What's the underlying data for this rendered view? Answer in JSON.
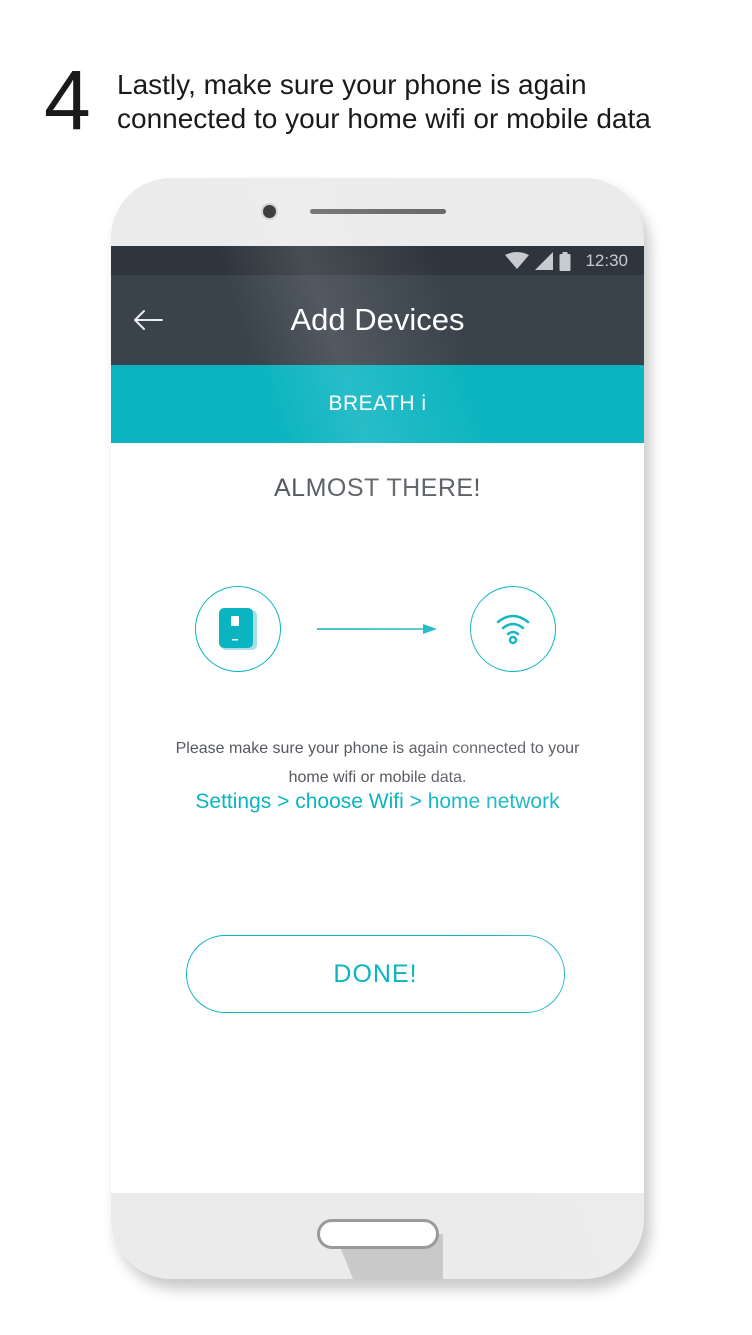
{
  "instruction": {
    "step_number": "4",
    "line1": "Lastly, make sure your phone is again",
    "line2": "connected to your home wifi or mobile data"
  },
  "status_bar": {
    "time": "12:30",
    "icons": [
      "wifi-icon",
      "signal-icon",
      "battery-icon"
    ]
  },
  "app_bar": {
    "title": "Add Devices",
    "back_icon": "back-arrow-icon"
  },
  "tab": {
    "label": "BREATH i"
  },
  "content": {
    "headline": "ALMOST THERE!",
    "device_icon": "air-purifier-icon",
    "target_icon": "wifi-icon",
    "instruction_line1": "Please make sure your phone is again connected to your",
    "instruction_line2": "home wifi or mobile data.",
    "settings_path": "Settings > choose Wifi > home network",
    "done_label": "DONE!"
  },
  "colors": {
    "accent": "#0ab4c0",
    "app_bar": "#3a424b",
    "status_bar": "#2f353c",
    "text": "#55595e"
  }
}
